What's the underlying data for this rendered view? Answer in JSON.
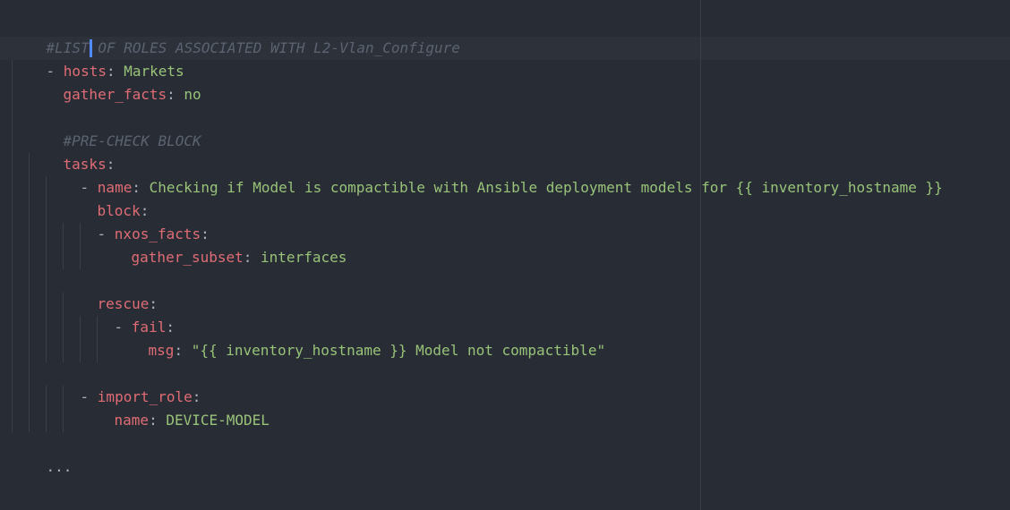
{
  "editor": {
    "language": "yaml",
    "colors": {
      "background": "#282c34",
      "comment": "#5c6370",
      "key": "#e06c75",
      "string": "#98c379",
      "punctuation": "#abb2bf",
      "cursor": "#528bff"
    },
    "lines": {
      "l1": {
        "comment": "#LIST OF ROLES ASSOCIATED WITH L2-Vlan_Configure"
      },
      "l2": {
        "dash": "- ",
        "key": "hosts",
        "colon": ": ",
        "value": "Markets"
      },
      "l3": {
        "key": "gather_facts",
        "colon": ": ",
        "value": "no"
      },
      "l5": {
        "comment": "#PRE-CHECK BLOCK"
      },
      "l6": {
        "key": "tasks",
        "colon": ":"
      },
      "l7": {
        "dash": "- ",
        "key": "name",
        "colon": ": ",
        "value": "Checking if Model is compactible with Ansible deployment models for {{ inventory_hostname }}"
      },
      "l8": {
        "key": "block",
        "colon": ":"
      },
      "l9": {
        "dash": "- ",
        "key": "nxos_facts",
        "colon": ":"
      },
      "l10": {
        "key": "gather_subset",
        "colon": ": ",
        "value": "interfaces"
      },
      "l12": {
        "key": "rescue",
        "colon": ":"
      },
      "l13": {
        "dash": "- ",
        "key": "fail",
        "colon": ":"
      },
      "l14": {
        "key": "msg",
        "colon": ": ",
        "value": "\"{{ inventory_hostname }} Model not compactible\""
      },
      "l16": {
        "dash": "- ",
        "key": "import_role",
        "colon": ":"
      },
      "l17": {
        "key": "name",
        "colon": ": ",
        "value": "DEVICE-MODEL"
      },
      "l19": {
        "text": "..."
      }
    }
  }
}
